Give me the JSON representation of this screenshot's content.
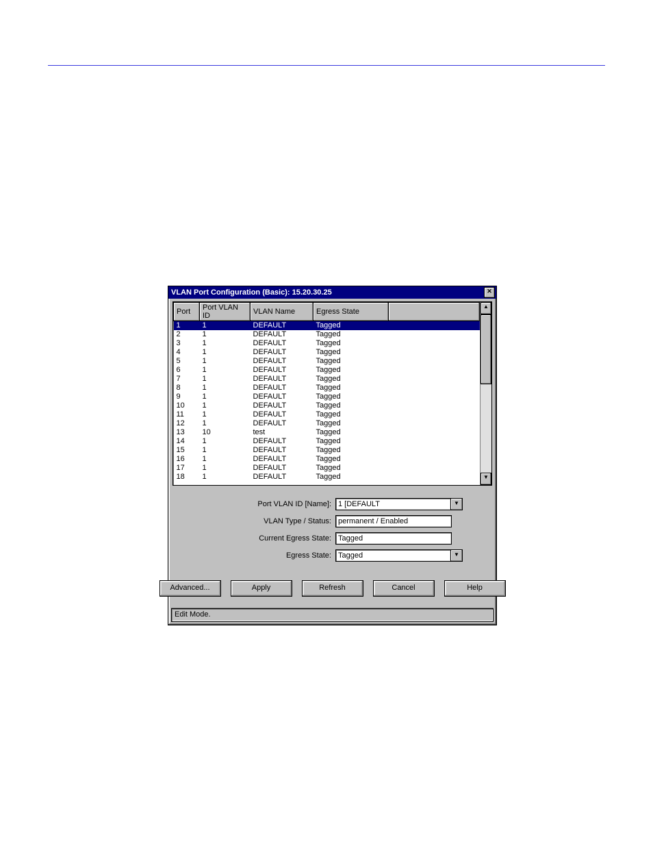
{
  "dialog": {
    "title": "VLAN Port Configuration (Basic): 15.20.30.25",
    "close_glyph": "✕"
  },
  "table": {
    "headers": [
      "Port",
      "Port VLAN ID",
      "VLAN Name",
      "Egress State"
    ],
    "rows": [
      {
        "port": "1",
        "pvid": "1",
        "name": "DEFAULT",
        "egress": "Tagged",
        "selected": true
      },
      {
        "port": "2",
        "pvid": "1",
        "name": "DEFAULT",
        "egress": "Tagged"
      },
      {
        "port": "3",
        "pvid": "1",
        "name": "DEFAULT",
        "egress": "Tagged"
      },
      {
        "port": "4",
        "pvid": "1",
        "name": "DEFAULT",
        "egress": "Tagged"
      },
      {
        "port": "5",
        "pvid": "1",
        "name": "DEFAULT",
        "egress": "Tagged"
      },
      {
        "port": "6",
        "pvid": "1",
        "name": "DEFAULT",
        "egress": "Tagged"
      },
      {
        "port": "7",
        "pvid": "1",
        "name": "DEFAULT",
        "egress": "Tagged"
      },
      {
        "port": "8",
        "pvid": "1",
        "name": "DEFAULT",
        "egress": "Tagged"
      },
      {
        "port": "9",
        "pvid": "1",
        "name": "DEFAULT",
        "egress": "Tagged"
      },
      {
        "port": "10",
        "pvid": "1",
        "name": "DEFAULT",
        "egress": "Tagged"
      },
      {
        "port": "11",
        "pvid": "1",
        "name": "DEFAULT",
        "egress": "Tagged"
      },
      {
        "port": "12",
        "pvid": "1",
        "name": "DEFAULT",
        "egress": "Tagged"
      },
      {
        "port": "13",
        "pvid": "10",
        "name": "test",
        "egress": "Tagged"
      },
      {
        "port": "14",
        "pvid": "1",
        "name": "DEFAULT",
        "egress": "Tagged"
      },
      {
        "port": "15",
        "pvid": "1",
        "name": "DEFAULT",
        "egress": "Tagged"
      },
      {
        "port": "16",
        "pvid": "1",
        "name": "DEFAULT",
        "egress": "Tagged"
      },
      {
        "port": "17",
        "pvid": "1",
        "name": "DEFAULT",
        "egress": "Tagged"
      },
      {
        "port": "18",
        "pvid": "1",
        "name": "DEFAULT",
        "egress": "Tagged"
      }
    ]
  },
  "form": {
    "pvid_label": "Port VLAN ID  [Name]:",
    "pvid_value": "1      [DEFAULT",
    "type_label": "VLAN Type / Status:",
    "type_value": "permanent / Enabled",
    "curr_egress_label": "Current Egress State:",
    "curr_egress_value": "Tagged",
    "egress_label": "Egress State:",
    "egress_value": "Tagged"
  },
  "buttons": {
    "advanced": "Advanced...",
    "apply": "Apply",
    "refresh": "Refresh",
    "cancel": "Cancel",
    "help": "Help"
  },
  "status": "Edit Mode.",
  "glyphs": {
    "up": "▲",
    "down": "▼"
  }
}
